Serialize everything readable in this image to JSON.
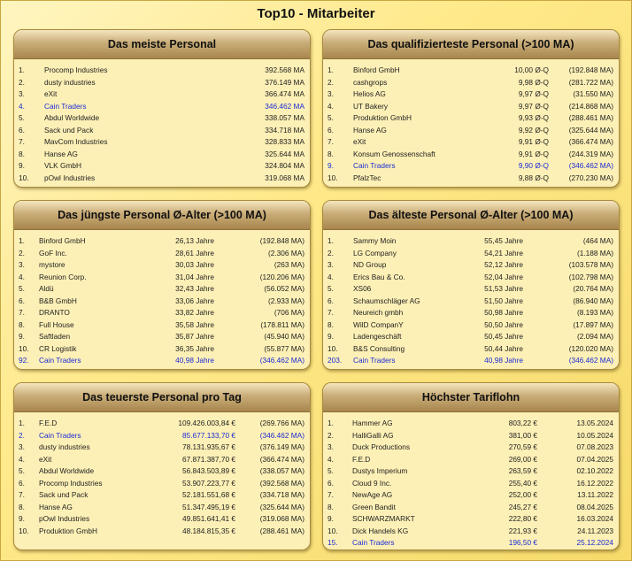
{
  "title": "Top10 - Mitarbeiter",
  "panels": [
    {
      "title": "Das meiste Personal",
      "rows": [
        {
          "rank": "1.",
          "name": "Procomp Industries",
          "value": "392.568 MA",
          "extra": ""
        },
        {
          "rank": "2.",
          "name": "dusty industries",
          "value": "376.149 MA",
          "extra": ""
        },
        {
          "rank": "3.",
          "name": "eXit",
          "value": "366.474 MA",
          "extra": ""
        },
        {
          "rank": "4.",
          "name": "Cain Traders",
          "value": "346.462 MA",
          "extra": "",
          "highlight": true
        },
        {
          "rank": "5.",
          "name": "Abdul Worldwide",
          "value": "338.057 MA",
          "extra": ""
        },
        {
          "rank": "6.",
          "name": "Sack und Pack",
          "value": "334.718 MA",
          "extra": ""
        },
        {
          "rank": "7.",
          "name": "MavCom Industries",
          "value": "328.833 MA",
          "extra": ""
        },
        {
          "rank": "8.",
          "name": "Hanse AG",
          "value": "325.644 MA",
          "extra": ""
        },
        {
          "rank": "9.",
          "name": "VLK GmbH",
          "value": "324.804 MA",
          "extra": ""
        },
        {
          "rank": "10.",
          "name": "pOwl Industries",
          "value": "319.068 MA",
          "extra": ""
        }
      ]
    },
    {
      "title": "Das qualifizierteste Personal (>100 MA)",
      "rows": [
        {
          "rank": "1.",
          "name": "Binford GmbH",
          "value": "10,00 Ø-Q",
          "extra": "(192.848 MA)"
        },
        {
          "rank": "2.",
          "name": "cashgrops",
          "value": "9,98 Ø-Q",
          "extra": "(281.722 MA)"
        },
        {
          "rank": "3.",
          "name": "Helios AG",
          "value": "9,97 Ø-Q",
          "extra": "(31.550 MA)"
        },
        {
          "rank": "4.",
          "name": "UT Bakery",
          "value": "9,97 Ø-Q",
          "extra": "(214.868 MA)"
        },
        {
          "rank": "5.",
          "name": "Produktion GmbH",
          "value": "9,93 Ø-Q",
          "extra": "(288.461 MA)"
        },
        {
          "rank": "6.",
          "name": "Hanse AG",
          "value": "9,92 Ø-Q",
          "extra": "(325.644 MA)"
        },
        {
          "rank": "7.",
          "name": "eXit",
          "value": "9,91 Ø-Q",
          "extra": "(366.474 MA)"
        },
        {
          "rank": "8.",
          "name": "Konsum Genossenschaft",
          "value": "9,91 Ø-Q",
          "extra": "(244.319 MA)"
        },
        {
          "rank": "9.",
          "name": "Cain Traders",
          "value": "9,90 Ø-Q",
          "extra": "(346.462 MA)",
          "highlight": true
        },
        {
          "rank": "10.",
          "name": "PfalzTec",
          "value": "9,88 Ø-Q",
          "extra": "(270.230 MA)"
        }
      ]
    },
    {
      "title": "Das jüngste Personal Ø-Alter (>100 MA)",
      "rows": [
        {
          "rank": "1.",
          "name": "Binford GmbH",
          "value": "26,13 Jahre",
          "extra": "(192.848 MA)"
        },
        {
          "rank": "2.",
          "name": "GoF Inc.",
          "value": "28,61 Jahre",
          "extra": "(2.306 MA)"
        },
        {
          "rank": "3.",
          "name": "mystore",
          "value": "30,03 Jahre",
          "extra": "(263 MA)"
        },
        {
          "rank": "4.",
          "name": "Reunion Corp.",
          "value": "31,04 Jahre",
          "extra": "(120.206 MA)"
        },
        {
          "rank": "5.",
          "name": "Aldü",
          "value": "32,43 Jahre",
          "extra": "(56.052 MA)"
        },
        {
          "rank": "6.",
          "name": "B&B GmbH",
          "value": "33,06 Jahre",
          "extra": "(2.933 MA)"
        },
        {
          "rank": "7.",
          "name": "DRANTO",
          "value": "33,82 Jahre",
          "extra": "(706 MA)"
        },
        {
          "rank": "8.",
          "name": "Full House",
          "value": "35,58 Jahre",
          "extra": "(178.811 MA)"
        },
        {
          "rank": "9.",
          "name": "Saftladen",
          "value": "35,87 Jahre",
          "extra": "(45.940 MA)"
        },
        {
          "rank": "10.",
          "name": "CR Logistik",
          "value": "36,35 Jahre",
          "extra": "(55.877 MA)"
        },
        {
          "rank": "92.",
          "name": "Cain Traders",
          "value": "40,98 Jahre",
          "extra": "(346.462 MA)",
          "highlight": true
        }
      ]
    },
    {
      "title": "Das älteste Personal Ø-Alter (>100 MA)",
      "rows": [
        {
          "rank": "1.",
          "name": "Sammy Moin",
          "value": "55,45 Jahre",
          "extra": "(464 MA)"
        },
        {
          "rank": "2.",
          "name": "LG Company",
          "value": "54,21 Jahre",
          "extra": "(1.188 MA)"
        },
        {
          "rank": "3.",
          "name": "ND Group",
          "value": "52,12 Jahre",
          "extra": "(103.578 MA)"
        },
        {
          "rank": "4.",
          "name": "Erics Bau & Co.",
          "value": "52,04 Jahre",
          "extra": "(102.798 MA)"
        },
        {
          "rank": "5.",
          "name": "XS06",
          "value": "51,53 Jahre",
          "extra": "(20.764 MA)"
        },
        {
          "rank": "6.",
          "name": "Schaumschläger AG",
          "value": "51,50 Jahre",
          "extra": "(86.940 MA)"
        },
        {
          "rank": "7.",
          "name": "Neureich gmbh",
          "value": "50,98 Jahre",
          "extra": "(8.193 MA)"
        },
        {
          "rank": "8.",
          "name": "WilD CompanY",
          "value": "50,50 Jahre",
          "extra": "(17.897 MA)"
        },
        {
          "rank": "9.",
          "name": "Ladengeschäft",
          "value": "50,45 Jahre",
          "extra": "(2.094 MA)"
        },
        {
          "rank": "10.",
          "name": "B&S Consulting",
          "value": "50,44 Jahre",
          "extra": "(120.020 MA)"
        },
        {
          "rank": "203.",
          "name": "Cain Traders",
          "value": "40,98 Jahre",
          "extra": "(346.462 MA)",
          "highlight": true
        }
      ]
    },
    {
      "title": "Das teuerste Personal pro Tag",
      "rows": [
        {
          "rank": "1.",
          "name": "F.E.D",
          "value": "109.426.003,84 €",
          "extra": "(269.766 MA)"
        },
        {
          "rank": "2.",
          "name": "Cain Traders",
          "value": "85.677.133,70 €",
          "extra": "(346.462 MA)",
          "highlight": true
        },
        {
          "rank": "3.",
          "name": "dusty industries",
          "value": "78.131.935,67 €",
          "extra": "(376.149 MA)"
        },
        {
          "rank": "4.",
          "name": "eXit",
          "value": "67.871.387,70 €",
          "extra": "(366.474 MA)"
        },
        {
          "rank": "5.",
          "name": "Abdul Worldwide",
          "value": "56.843.503,89 €",
          "extra": "(338.057 MA)"
        },
        {
          "rank": "6.",
          "name": "Procomp Industries",
          "value": "53.907.223,77 €",
          "extra": "(392.568 MA)"
        },
        {
          "rank": "7.",
          "name": "Sack und Pack",
          "value": "52.181.551,68 €",
          "extra": "(334.718 MA)"
        },
        {
          "rank": "8.",
          "name": "Hanse AG",
          "value": "51.347.495,19 €",
          "extra": "(325.644 MA)"
        },
        {
          "rank": "9.",
          "name": "pOwl Industries",
          "value": "49.851.641,41 €",
          "extra": "(319.068 MA)"
        },
        {
          "rank": "10.",
          "name": "Produktion GmbH",
          "value": "48.184.815,35 €",
          "extra": "(288.461 MA)"
        }
      ]
    },
    {
      "title": "Höchster Tariflohn",
      "rows": [
        {
          "rank": "1.",
          "name": "Hammer AG",
          "value": "803,22 €",
          "extra": "13.05.2024"
        },
        {
          "rank": "2.",
          "name": "HalliGalli AG",
          "value": "381,00 €",
          "extra": "10.05.2024"
        },
        {
          "rank": "3.",
          "name": "Duck Productions",
          "value": "270,59 €",
          "extra": "07.08.2023"
        },
        {
          "rank": "4.",
          "name": "F.E.D",
          "value": "269,00 €",
          "extra": "07.04.2025"
        },
        {
          "rank": "5.",
          "name": "Dustys Imperium",
          "value": "263,59 €",
          "extra": "02.10.2022"
        },
        {
          "rank": "6.",
          "name": "Cloud 9 Inc.",
          "value": "255,40 €",
          "extra": "16.12.2022"
        },
        {
          "rank": "7.",
          "name": "NewAge AG",
          "value": "252,00 €",
          "extra": "13.11.2022"
        },
        {
          "rank": "8.",
          "name": "Green Bandit",
          "value": "245,27 €",
          "extra": "08.04.2025"
        },
        {
          "rank": "9.",
          "name": "SCHWARZMARKT",
          "value": "222,80 €",
          "extra": "16.03.2024"
        },
        {
          "rank": "10.",
          "name": "Dick Handels KG",
          "value": "221,93 €",
          "extra": "24.11.2023"
        },
        {
          "rank": "15.",
          "name": "Cain Traders",
          "value": "196,50 €",
          "extra": "25.12.2024",
          "highlight": true
        }
      ]
    }
  ]
}
